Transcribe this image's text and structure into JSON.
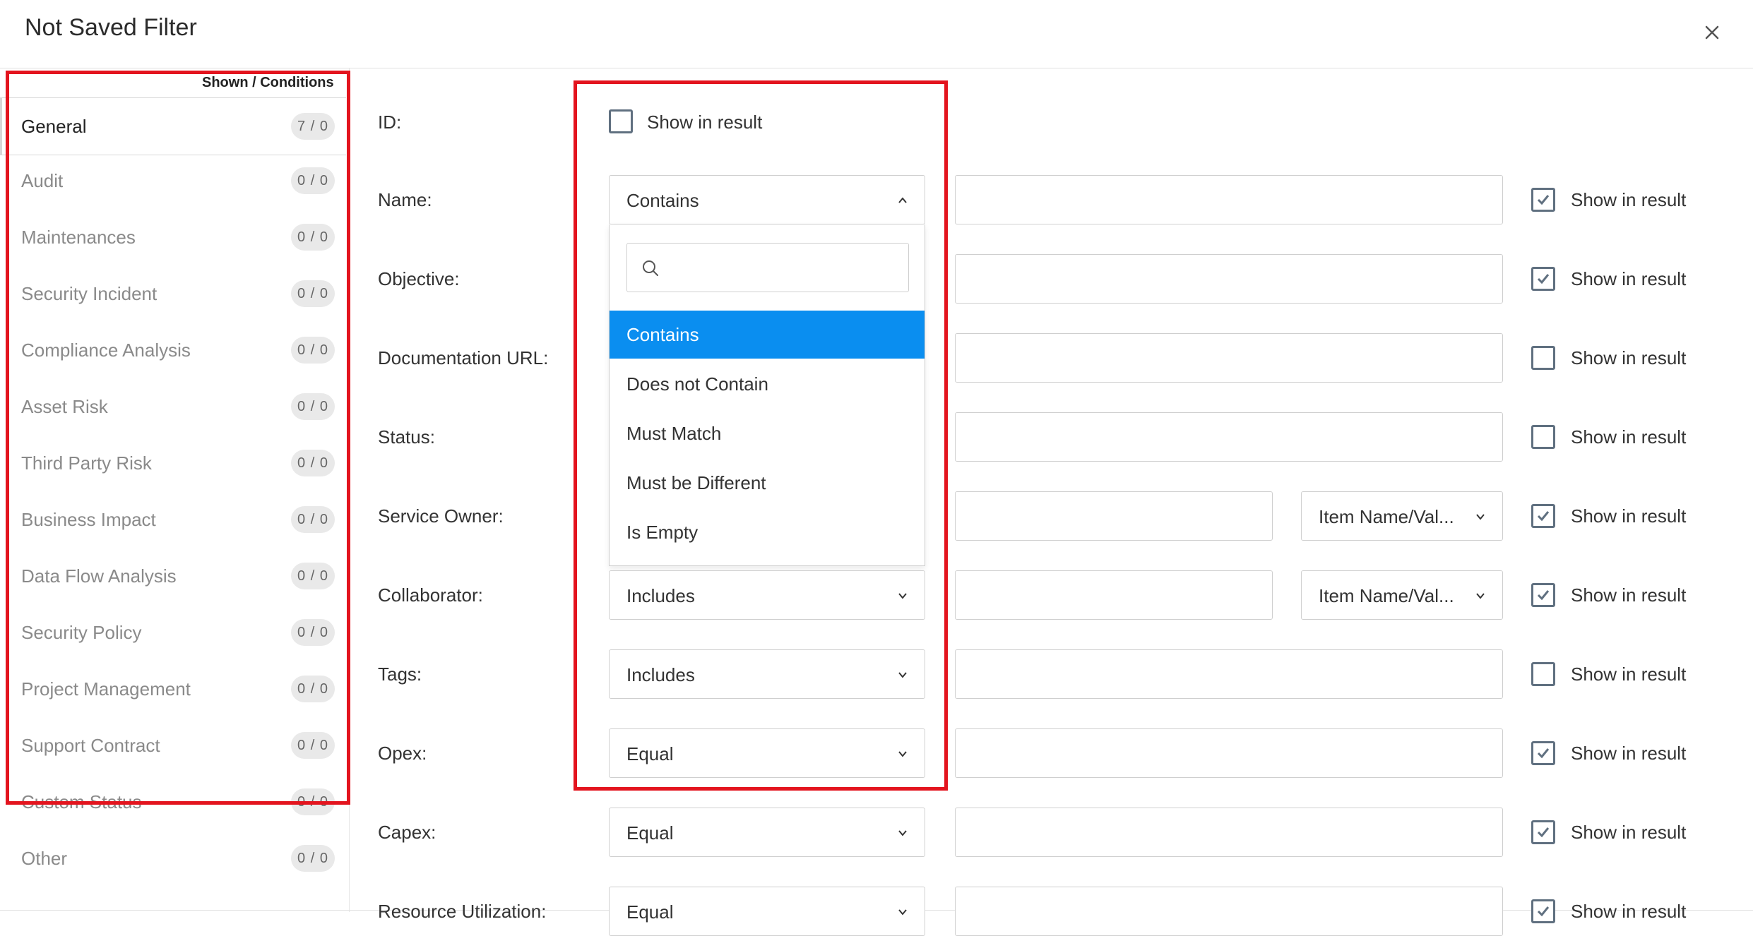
{
  "title": "Not Saved Filter",
  "sidebar": {
    "header": "Shown / Conditions",
    "items": [
      {
        "label": "General",
        "badge": "7 / 0"
      },
      {
        "label": "Audit",
        "badge": "0 / 0"
      },
      {
        "label": "Maintenances",
        "badge": "0 / 0"
      },
      {
        "label": "Security Incident",
        "badge": "0 / 0"
      },
      {
        "label": "Compliance Analysis",
        "badge": "0 / 0"
      },
      {
        "label": "Asset Risk",
        "badge": "0 / 0"
      },
      {
        "label": "Third Party Risk",
        "badge": "0 / 0"
      },
      {
        "label": "Business Impact",
        "badge": "0 / 0"
      },
      {
        "label": "Data Flow Analysis",
        "badge": "0 / 0"
      },
      {
        "label": "Security Policy",
        "badge": "0 / 0"
      },
      {
        "label": "Project Management",
        "badge": "0 / 0"
      },
      {
        "label": "Support Contract",
        "badge": "0 / 0"
      },
      {
        "label": "Custom Status",
        "badge": "0 / 0"
      },
      {
        "label": "Other",
        "badge": "0 / 0"
      }
    ]
  },
  "show_in_result": "Show in result",
  "fields": [
    {
      "label": "ID:",
      "checked": false
    },
    {
      "label": "Name:",
      "operator": "Contains",
      "checked": true
    },
    {
      "label": "Objective:",
      "checked": true
    },
    {
      "label": "Documentation URL:",
      "checked": false
    },
    {
      "label": "Status:",
      "checked": false
    },
    {
      "label": "Service Owner:",
      "secondary": "Item Name/Val...",
      "checked": true
    },
    {
      "label": "Collaborator:",
      "operator": "Includes",
      "secondary": "Item Name/Val...",
      "checked": true
    },
    {
      "label": "Tags:",
      "operator": "Includes",
      "checked": false
    },
    {
      "label": "Opex:",
      "operator": "Equal",
      "checked": true
    },
    {
      "label": "Capex:",
      "operator": "Equal",
      "checked": true
    },
    {
      "label": "Resource Utilization:",
      "operator": "Equal",
      "checked": true
    }
  ],
  "dropdown": {
    "search_placeholder": "",
    "options": [
      "Contains",
      "Does not Contain",
      "Must Match",
      "Must be Different",
      "Is Empty"
    ],
    "selected": "Contains"
  },
  "colors": {
    "highlight": "#e3141e",
    "selected_option": "#0a8ef0",
    "checkbox_border": "#607080"
  }
}
